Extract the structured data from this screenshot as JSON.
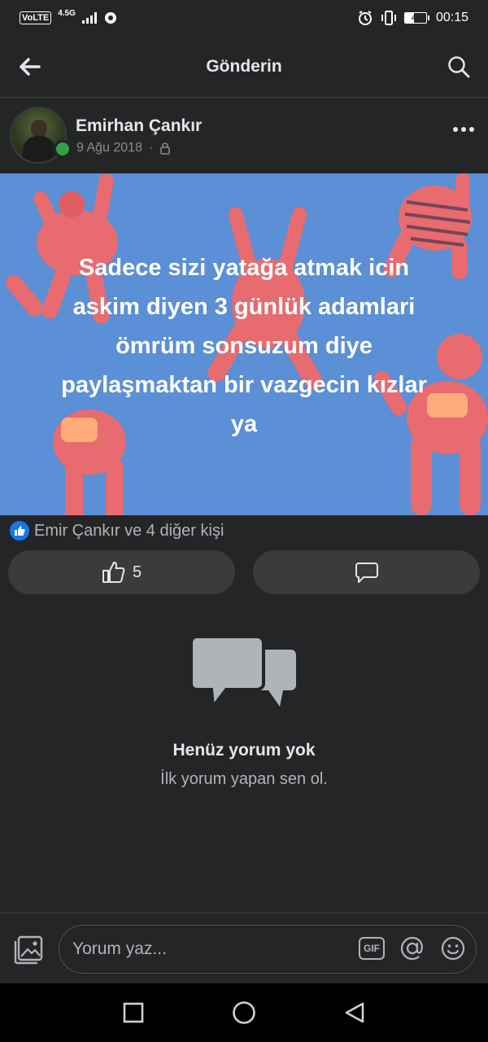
{
  "status_bar": {
    "volte": "VoLTE",
    "network": "4.5G",
    "battery": "41",
    "battery_level": 0.41,
    "time": "00:15",
    "icons": [
      "signal-icon",
      "sync-icon",
      "alarm-icon",
      "vibrate-icon",
      "battery-icon"
    ]
  },
  "header": {
    "title": "Gönderin",
    "back_icon": "back-arrow-icon",
    "search_icon": "search-icon"
  },
  "post": {
    "author": "Emirhan Çankır",
    "date": "9 Ağu 2018",
    "separator": "·",
    "privacy_icon": "lock-icon",
    "more_icon": "more-dots-icon",
    "text_lines": [
      "Sadece sizi yatağa atmak icin",
      "askim diyen 3 günlük adamlari",
      "ömrüm sonsuzum diye",
      "paylaşmaktan bir vazgecin kızlar",
      "ya"
    ],
    "background_color": "#5b8fd6",
    "figure_color": "#f26b6b"
  },
  "reactions": {
    "summary": "Emir Çankır ve 4 diğer kişi",
    "like_icon": "like-badge-icon"
  },
  "actions": {
    "like_count": "5",
    "like_icon": "thumbs-up-icon",
    "comment_icon": "comment-icon"
  },
  "empty_state": {
    "title": "Henüz yorum yok",
    "subtitle": "İlk yorum yapan sen ol.",
    "icon": "chat-bubbles-icon"
  },
  "composer": {
    "placeholder": "Yorum yaz...",
    "gif_label": "GIF",
    "photo_icon": "photo-icon",
    "mention_icon": "at-icon",
    "emoji_icon": "emoji-icon"
  },
  "nav": {
    "recents_icon": "square-icon",
    "home_icon": "circle-icon",
    "back_icon": "triangle-back-icon"
  }
}
